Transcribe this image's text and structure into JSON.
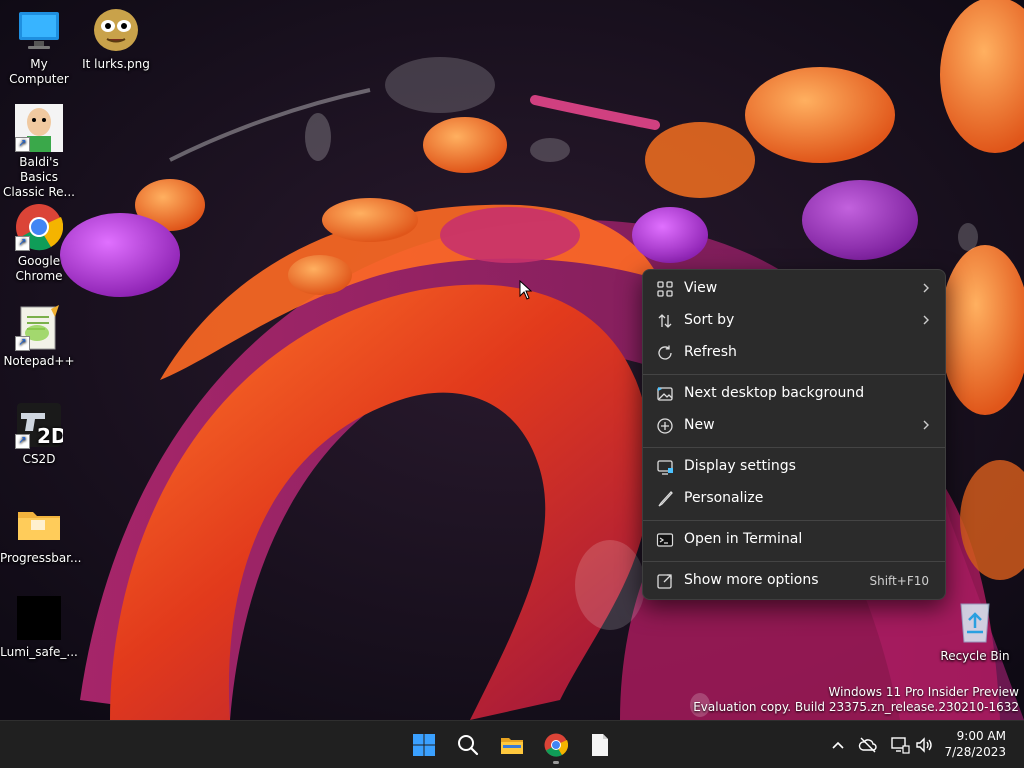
{
  "desktop": {
    "icons": [
      {
        "label": "My Computer"
      },
      {
        "label": "It lurks.png"
      },
      {
        "label": "Baldi's Basics Classic Re..."
      },
      {
        "label": "Google Chrome"
      },
      {
        "label": "Notepad++"
      },
      {
        "label": "CS2D"
      },
      {
        "label": "Progressbar..."
      },
      {
        "label": "Lumi_safe_..."
      },
      {
        "label": "Recycle Bin"
      }
    ]
  },
  "context_menu": {
    "items": [
      {
        "label": "View",
        "icon": "grid-view-icon",
        "has_submenu": true
      },
      {
        "label": "Sort by",
        "icon": "sort-arrows-icon",
        "has_submenu": true
      },
      {
        "label": "Refresh",
        "icon": "refresh-icon"
      },
      {
        "label": "Next desktop background",
        "icon": "image-next-icon"
      },
      {
        "label": "New",
        "icon": "plus-circle-icon",
        "has_submenu": true
      },
      {
        "label": "Display settings",
        "icon": "monitor-icon"
      },
      {
        "label": "Personalize",
        "icon": "brush-icon"
      },
      {
        "label": "Open in Terminal",
        "icon": "terminal-icon"
      },
      {
        "label": "Show more options",
        "icon": "share-icon",
        "shortcut": "Shift+F10"
      }
    ]
  },
  "watermark": {
    "line1": "Windows 11 Pro Insider Preview",
    "line2": "Evaluation copy. Build 23375.zn_release.230210-1632"
  },
  "taskbar": {
    "apps": [
      "start-icon",
      "search-icon",
      "file-explorer-icon",
      "chrome-icon",
      "notepad-icon"
    ],
    "clock": {
      "time": "9:00 AM",
      "date": "7/28/2023"
    }
  },
  "colors": {
    "menu_bg": "#2b2b2b",
    "taskbar_bg": "#202020",
    "accent_blue": "#4cc2ff"
  }
}
